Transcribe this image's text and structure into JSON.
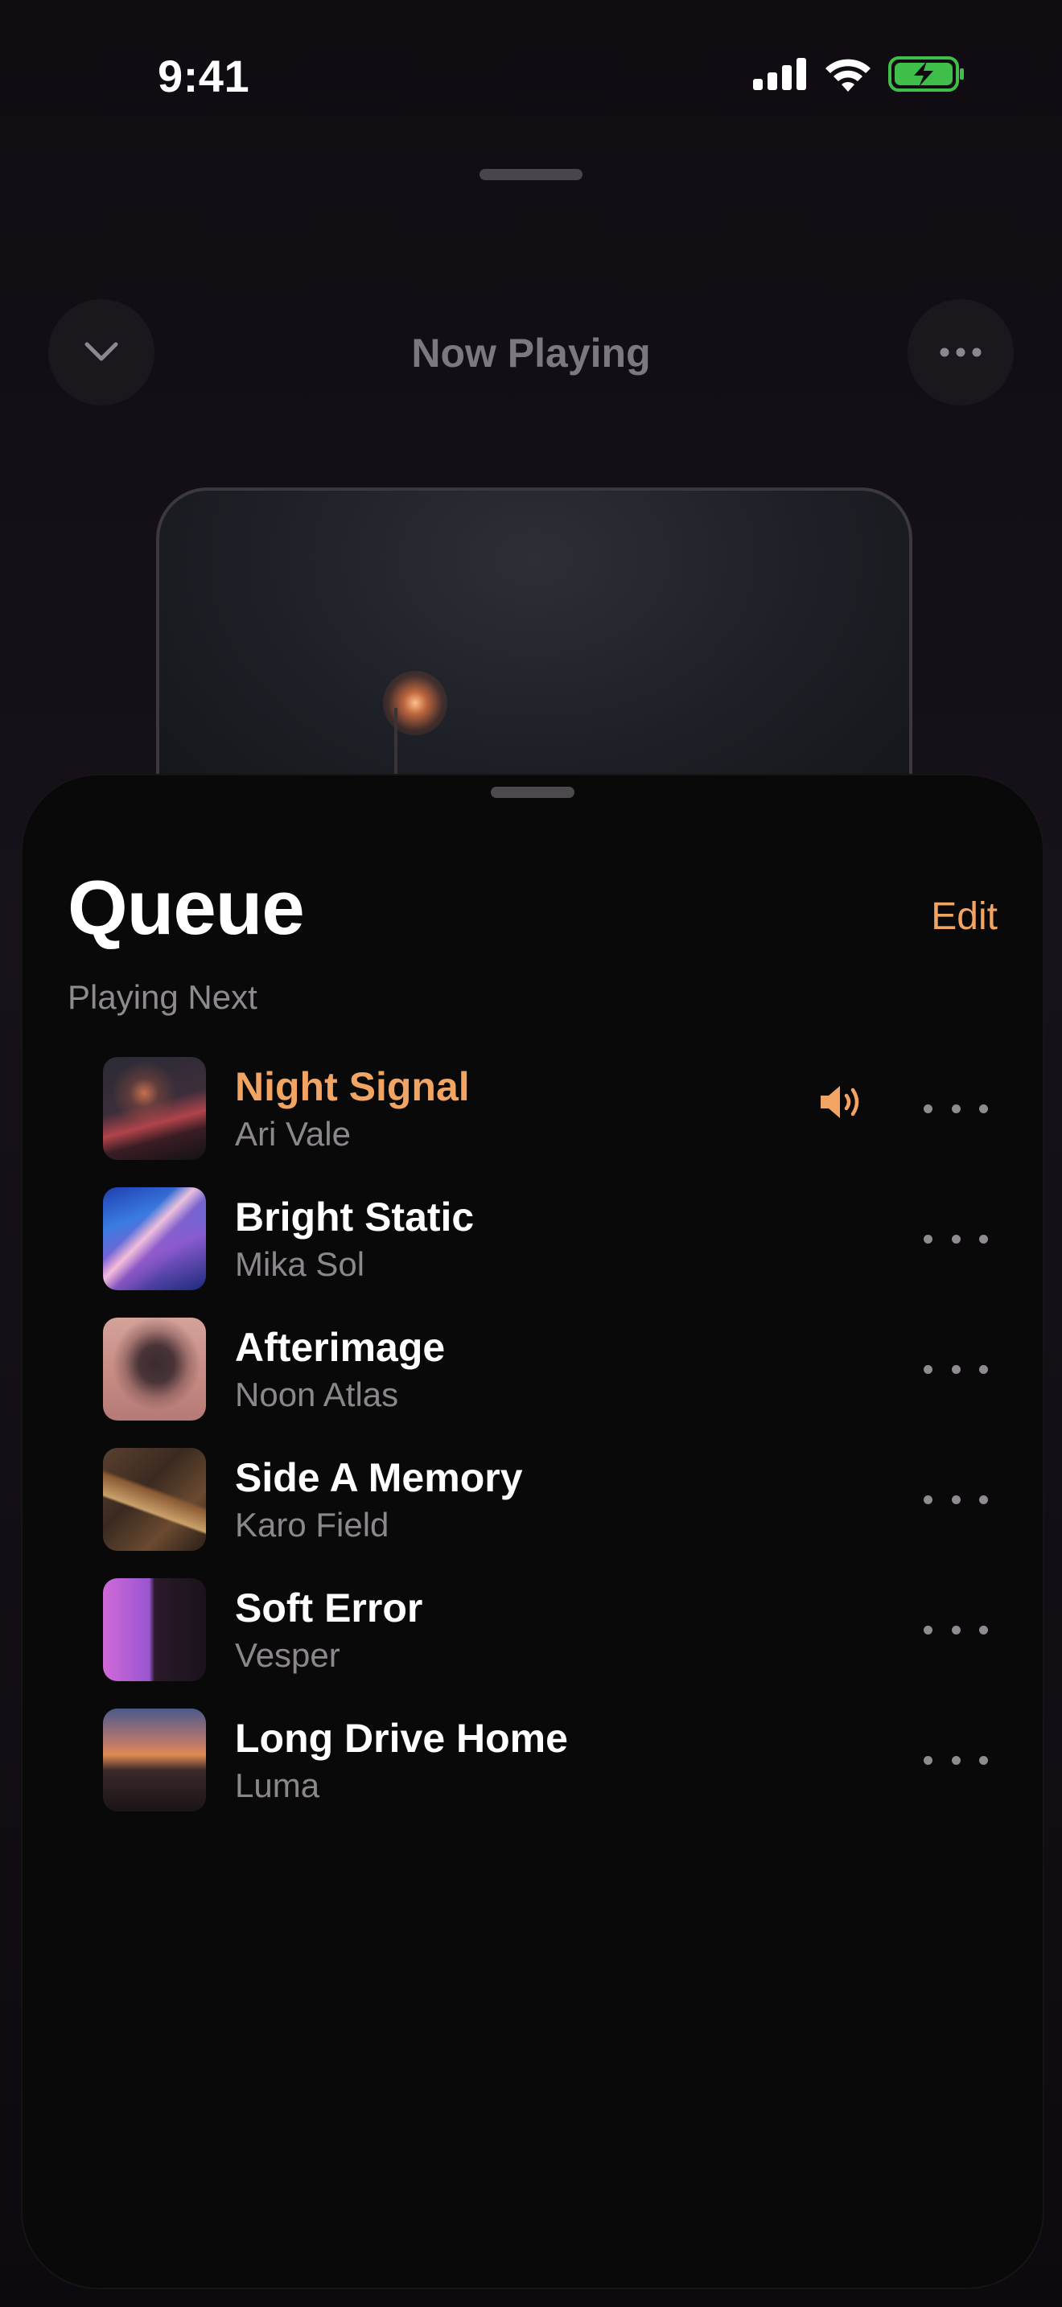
{
  "status_bar": {
    "time": "9:41",
    "icons": [
      "signal-icon",
      "wifi-icon",
      "battery-charging-icon"
    ]
  },
  "header": {
    "title": "Now Playing",
    "left_icon": "chevron-down-icon",
    "right_icon": "more-icon"
  },
  "queue": {
    "title": "Queue",
    "edit_label": "Edit",
    "section_label": "Playing Next",
    "accent_color": "#f2a463",
    "tracks": [
      {
        "title": "Night Signal",
        "artist": "Ari Vale",
        "now_playing": true
      },
      {
        "title": "Bright Static",
        "artist": "Mika Sol",
        "now_playing": false
      },
      {
        "title": "Afterimage",
        "artist": "Noon Atlas",
        "now_playing": false
      },
      {
        "title": "Side A Memory",
        "artist": "Karo Field",
        "now_playing": false
      },
      {
        "title": "Soft Error",
        "artist": "Vesper",
        "now_playing": false
      },
      {
        "title": "Long Drive Home",
        "artist": "Luma",
        "now_playing": false
      }
    ]
  }
}
